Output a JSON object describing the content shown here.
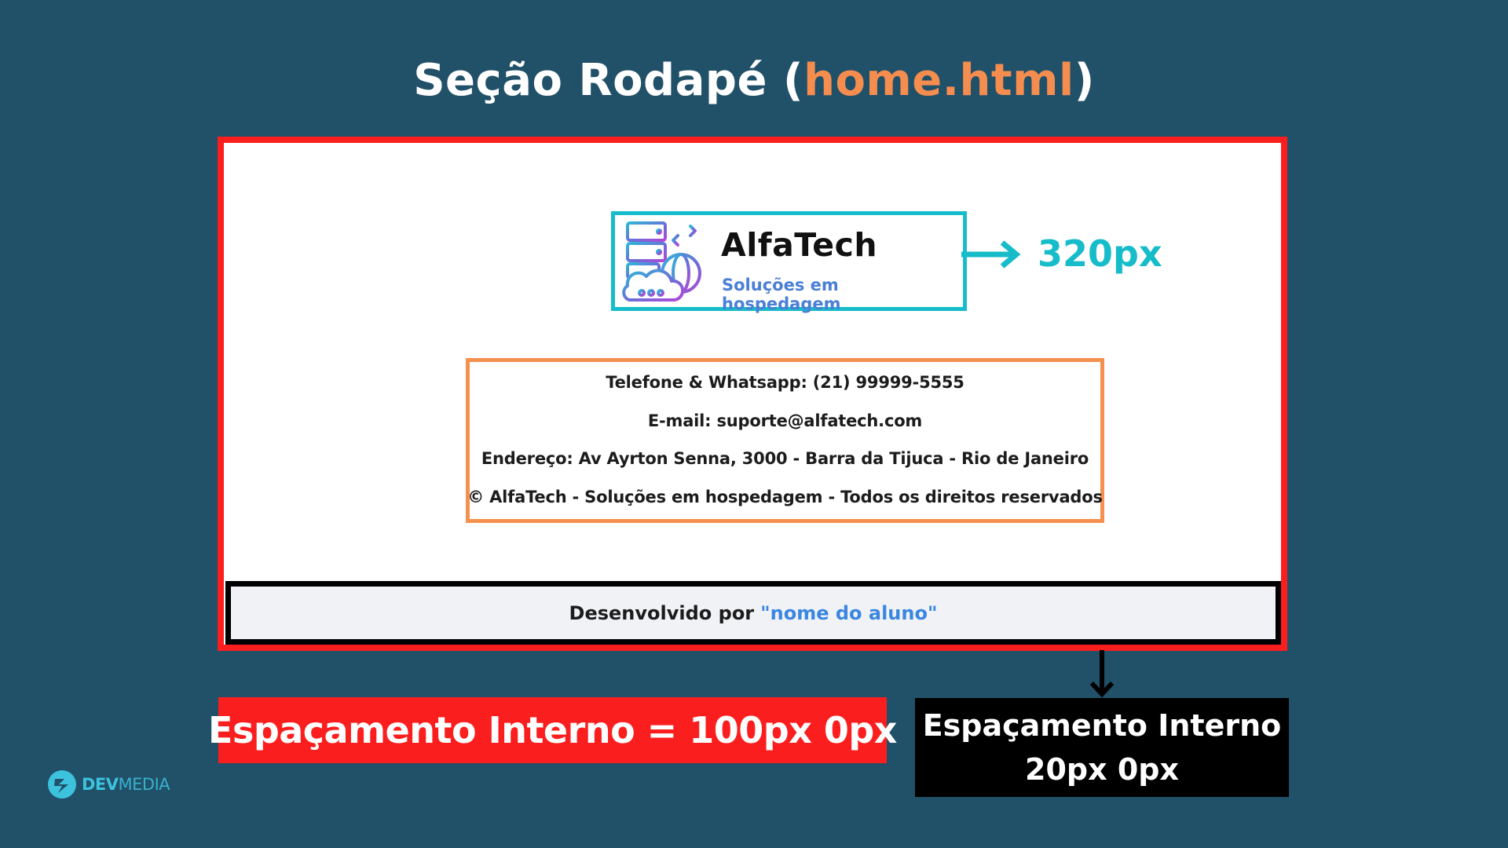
{
  "title": {
    "prefix": "Seção Rodapé (",
    "highlight": "home.html",
    "suffix": ")"
  },
  "logo": {
    "name": "AlfaTech",
    "subtitle": "Soluções em hospedagem"
  },
  "width_label": "320px",
  "contact": {
    "phone": "Telefone & Whatsapp: (21) 99999-5555",
    "email": "E-mail: suporte@alfatech.com",
    "address": "Endereço: Av Ayrton Senna, 3000 - Barra da Tijuca - Rio de Janeiro",
    "copyright": "© AlfaTech - Soluções em hospedagem - Todos os direitos reservados"
  },
  "credit": {
    "prefix": "Desenvolvido por",
    "student": "\"nome do aluno\""
  },
  "labels": {
    "outer_padding": "Espaçamento Interno = 100px 0px",
    "inner_padding_line1": "Espaçamento Interno",
    "inner_padding_line2": "20px 0px"
  },
  "brand": {
    "bold": "DEV",
    "light": "MEDIA"
  },
  "colors": {
    "background": "#215069",
    "accent_orange": "#f58d4f",
    "outer_border_red": "#fb1e1e",
    "logo_border_cyan": "#16bcc9",
    "contact_border_orange": "#f5904f",
    "credit_border_black": "#000000",
    "student_blue": "#3a86e0"
  },
  "icons": {
    "logo": "server-cloud-globe-icon",
    "width_arrow": "arrow-right-icon",
    "padding_arrow": "arrow-down-icon",
    "brand": "devmedia-logo-icon"
  }
}
